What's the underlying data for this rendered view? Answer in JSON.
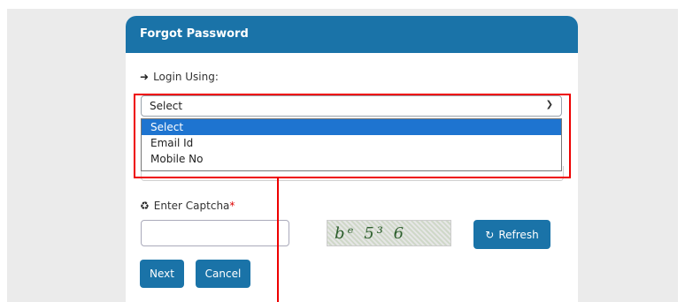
{
  "card": {
    "title": "Forgot Password"
  },
  "login": {
    "label": "Login Using:",
    "selected": "Select",
    "options": [
      "Select",
      "Email Id",
      "Mobile No"
    ]
  },
  "captcha": {
    "label": "Enter Captcha",
    "required_mark": "*",
    "code": "bᵉ 5³ 6",
    "input_value": ""
  },
  "buttons": {
    "refresh": "Refresh",
    "next": "Next",
    "cancel": "Cancel"
  },
  "icons": {
    "login": "sign-in-icon",
    "captcha": "recycle-icon",
    "refresh": "refresh-icon",
    "dropdown": "chevron-down-icon"
  },
  "colors": {
    "primary": "#1a73a8",
    "highlight": "#e00000",
    "selected_option": "#1e74d0"
  }
}
